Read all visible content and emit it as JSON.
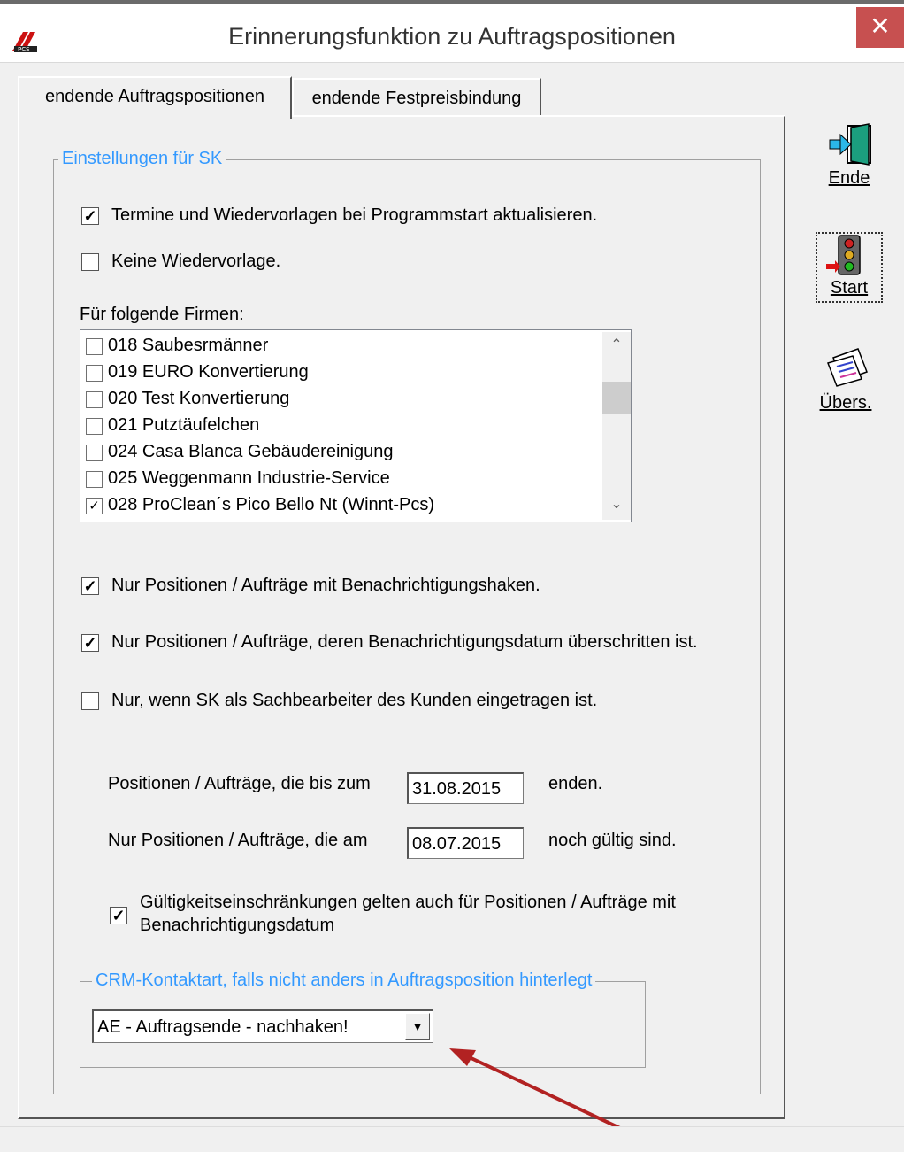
{
  "window": {
    "title": "Erinnerungsfunktion zu Auftragspositionen",
    "close_glyph": "✕",
    "logo_icon": "pcs-logo-icon"
  },
  "tabs": [
    {
      "label": "endende Auftragspositionen",
      "active": true
    },
    {
      "label": "endende Festpreisbindung",
      "active": false
    }
  ],
  "settings_group": {
    "label": "Einstellungen für SK",
    "update_on_start": {
      "label": "Termine und Wiedervorlagen bei Programmstart aktualisieren.",
      "checked": true
    },
    "no_resubmission": {
      "label": "Keine Wiedervorlage.",
      "checked": false
    },
    "companies_label": "Für folgende Firmen:",
    "companies": [
      {
        "label": "018  Saubesrmänner",
        "checked": false
      },
      {
        "label": "019  EURO Konvertierung",
        "checked": false
      },
      {
        "label": "020  Test Konvertierung",
        "checked": false
      },
      {
        "label": "021  Putztäufelchen",
        "checked": false
      },
      {
        "label": "024  Casa Blanca Gebäudereinigung",
        "checked": false
      },
      {
        "label": "025  Weggenmann Industrie-Service",
        "checked": false
      },
      {
        "label": "028  ProClean´s Pico Bello Nt (Winnt-Pcs)",
        "checked": true
      }
    ],
    "only_notification_flag": {
      "label": "Nur Positionen / Aufträge mit Benachrichtigungshaken.",
      "checked": true
    },
    "only_date_exceeded": {
      "label": "Nur Positionen / Aufträge, deren Benachrichtigungsdatum überschritten ist.",
      "checked": true
    },
    "only_if_clerk": {
      "label": "Nur, wenn SK als Sachbearbeiter des Kunden eingetragen ist.",
      "checked": false
    },
    "ending_until": {
      "prefix": "Positionen / Aufträge, die bis zum",
      "value": "31.08.2015",
      "suffix": "enden."
    },
    "valid_on": {
      "prefix": "Nur Positionen / Aufträge, die am",
      "value": "08.07.2015",
      "suffix": "noch gültig sind."
    },
    "validity_restriction": {
      "label_line1": "Gültigkeitseinschränkungen gelten auch für Positionen / Aufträge mit",
      "label_line2": "Benachrichtigungsdatum",
      "checked": true
    }
  },
  "crm_group": {
    "label": "CRM-Kontaktart, falls nicht anders in Auftragsposition hinterlegt",
    "selected": "AE  -  Auftragsende - nachhaken!"
  },
  "side_buttons": [
    {
      "label": "Ende",
      "icon": "exit-door-icon"
    },
    {
      "label": "Start",
      "icon": "traffic-light-icon"
    },
    {
      "label": "Übers.",
      "icon": "overview-pages-icon"
    }
  ],
  "colors": {
    "group_label": "#3399ff",
    "close_button": "#c75050",
    "annotation_arrow": "#b22222"
  }
}
